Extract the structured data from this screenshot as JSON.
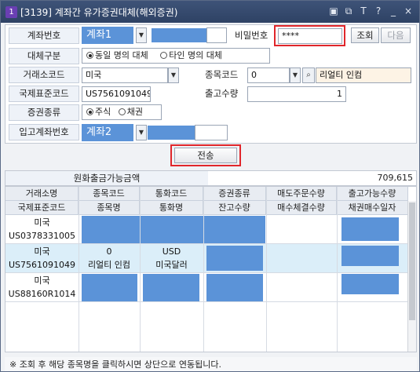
{
  "window": {
    "icon_text": "1",
    "title": "[3139] 계좌간 유가증권대체(해외증권)",
    "toolbar_icons": [
      "window-icon",
      "copy-icon",
      "text-icon",
      "help-icon",
      "minimize-icon",
      "close-icon"
    ],
    "toolbar_glyphs": [
      "▣",
      "⧉",
      "T",
      "?",
      "_",
      "×"
    ]
  },
  "form": {
    "account_label": "계좌번호",
    "account_value": "계좌1",
    "password_label": "비밀번호",
    "password_value": "****",
    "query_button": "조회",
    "next_button": "다음",
    "transfer_type_label": "대체구분",
    "transfer_type_options": [
      "동일 명의 대체",
      "타인 명의 대체"
    ],
    "transfer_type_selected": 0,
    "exchange_code_label": "거래소코드",
    "exchange_code_value": "미국",
    "stock_code_label": "종목코드",
    "stock_code_value": "0",
    "stock_name_value": "리얼티 인컴",
    "isin_label": "국제표준코드",
    "isin_value": "US7561091049",
    "outgoing_qty_label": "출고수량",
    "outgoing_qty_value": "1",
    "security_type_label": "증권종류",
    "security_type_options": [
      "주식",
      "채권"
    ],
    "security_type_selected": 0,
    "incoming_account_label": "입고계좌번호",
    "incoming_account_value": "계좌2",
    "send_button": "전송"
  },
  "summary": {
    "label": "원화출금가능금액",
    "value": "709,615"
  },
  "table": {
    "header_row1": [
      "거래소명",
      "종목코드",
      "통화코드",
      "증권종류",
      "매도주문수량",
      "출고가능수량"
    ],
    "header_row2": [
      "국제표준코드",
      "종목명",
      "통화명",
      "잔고수량",
      "매수체결수량",
      "채권매수일자"
    ],
    "rows": [
      {
        "exchange": "미국",
        "isin": "US0378331005",
        "code": "",
        "name": "",
        "currency": "",
        "currency_name": "",
        "selected": false
      },
      {
        "exchange": "미국",
        "isin": "US7561091049",
        "code": "0",
        "name": "리얼티 인컴",
        "currency": "USD",
        "currency_name": "미국달러",
        "selected": true
      },
      {
        "exchange": "미국",
        "isin": "US88160R1014",
        "code": "",
        "name": "",
        "currency": "",
        "currency_name": "",
        "selected": false
      }
    ]
  },
  "footer": {
    "note": "※ 조회 후 해당 종목명을 클릭하시면 상단으로 연동됩니다."
  },
  "colors": {
    "title_bar": "#34496d",
    "masked_block": "#5b93d8",
    "highlight_border": "#e0262b",
    "selected_row": "#dbeef9"
  }
}
